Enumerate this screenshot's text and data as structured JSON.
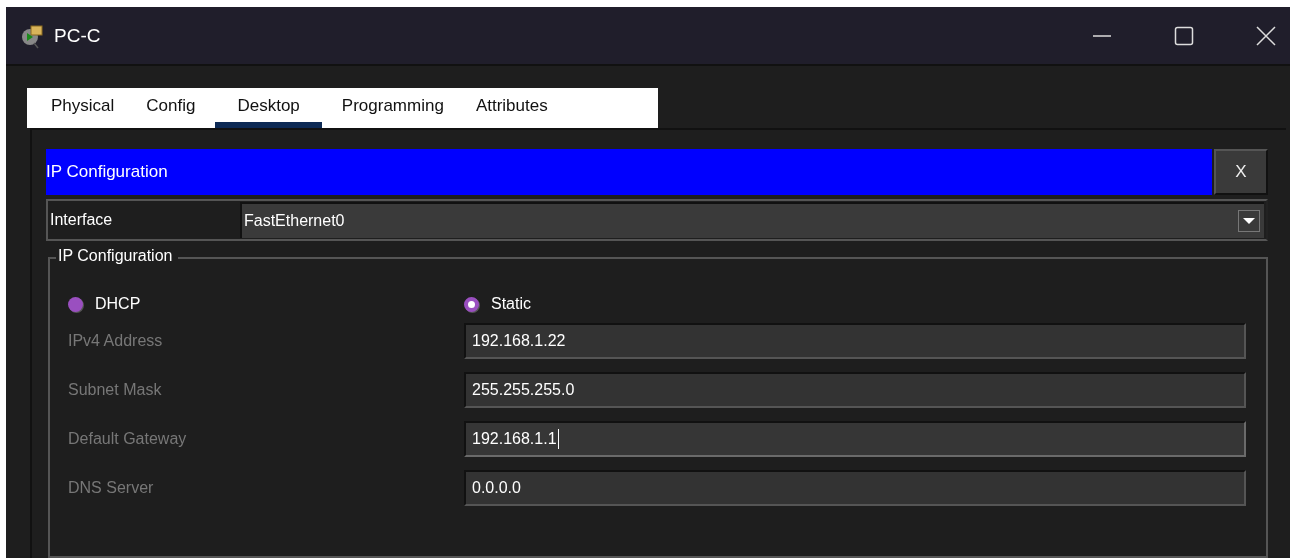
{
  "window": {
    "title": "PC-C"
  },
  "tabs": [
    {
      "label": "Physical",
      "selected": false
    },
    {
      "label": "Config",
      "selected": false
    },
    {
      "label": "Desktop",
      "selected": true
    },
    {
      "label": "Programming",
      "selected": false
    },
    {
      "label": "Attributes",
      "selected": false
    }
  ],
  "panel": {
    "title": "IP Configuration",
    "close": "X"
  },
  "interface": {
    "label": "Interface",
    "value": "FastEthernet0"
  },
  "group": {
    "title": "IP Configuration",
    "modes": [
      {
        "label": "DHCP",
        "selected": false
      },
      {
        "label": "Static",
        "selected": true
      }
    ],
    "fields": [
      {
        "label": "IPv4 Address",
        "value": "192.168.1.22",
        "focused": false
      },
      {
        "label": "Subnet Mask",
        "value": "255.255.255.0",
        "focused": false
      },
      {
        "label": "Default Gateway",
        "value": "192.168.1.1",
        "focused": true
      },
      {
        "label": "DNS Server",
        "value": "0.0.0.0",
        "focused": false
      }
    ]
  }
}
